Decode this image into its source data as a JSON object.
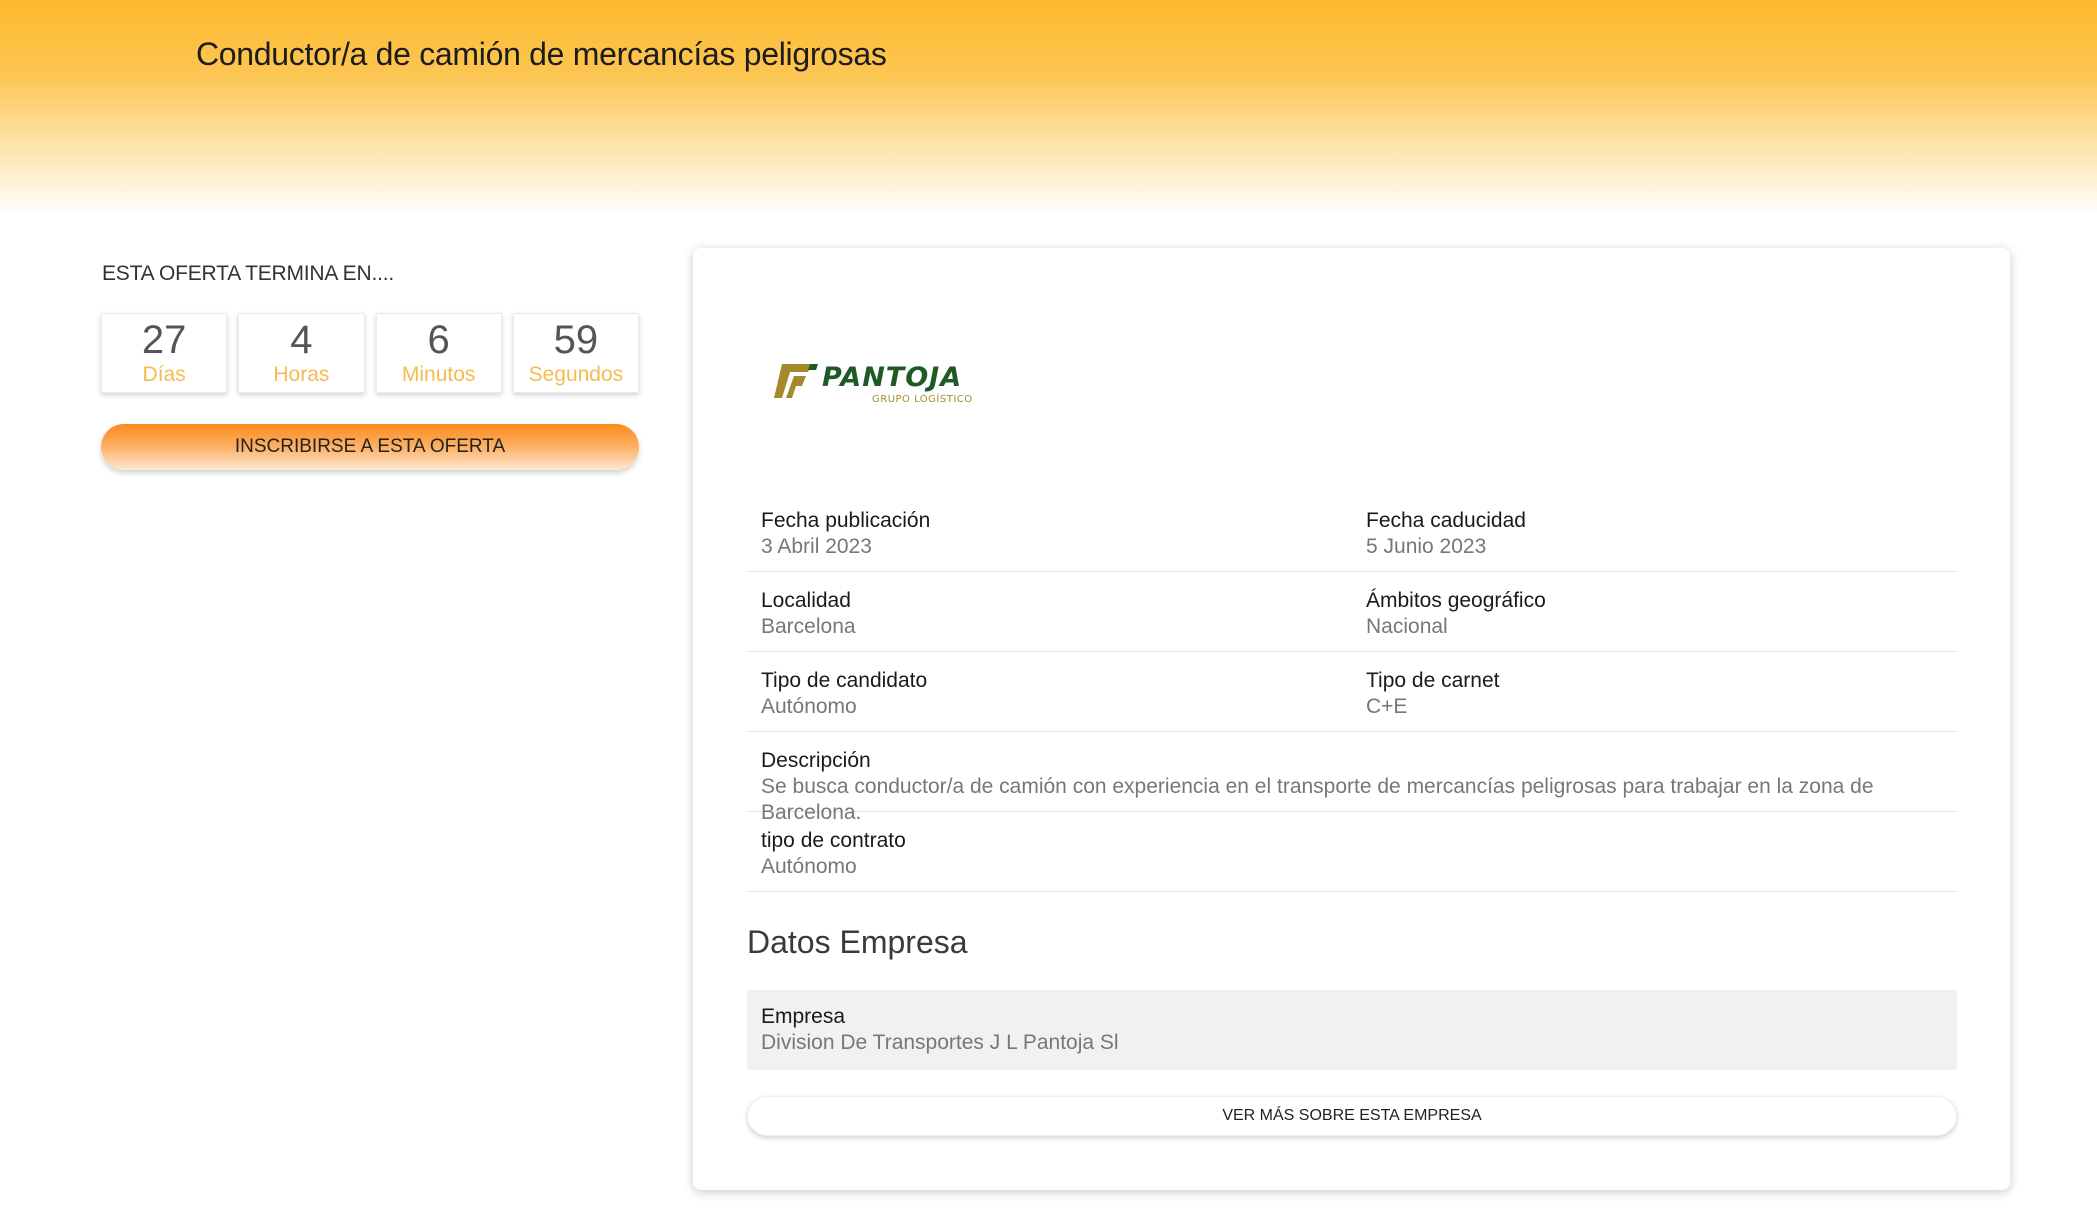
{
  "header": {
    "title": "Conductor/a de camión de mercancías peligrosas"
  },
  "countdown": {
    "title": "ESTA OFERTA TERMINA EN....",
    "units": [
      {
        "value": "27",
        "label": "Días"
      },
      {
        "value": "4",
        "label": "Horas"
      },
      {
        "value": "6",
        "label": "Minutos"
      },
      {
        "value": "59",
        "label": "Segundos"
      }
    ],
    "apply_label": "INSCRIBIRSE A ESTA OFERTA"
  },
  "logo": {
    "name": "PANTOJA",
    "subtitle": "GRUPO LOGÍSTICO"
  },
  "details": {
    "publication": {
      "label": "Fecha publicación",
      "value": "3 Abril 2023"
    },
    "expiry": {
      "label": "Fecha caducidad",
      "value": "5 Junio 2023"
    },
    "location": {
      "label": "Localidad",
      "value": "Barcelona"
    },
    "scope": {
      "label": "Ámbitos geográfico",
      "value": "Nacional"
    },
    "candidate_type": {
      "label": "Tipo de candidato",
      "value": "Autónomo"
    },
    "license_type": {
      "label": "Tipo de carnet",
      "value": "C+E"
    },
    "description": {
      "label": "Descripción",
      "value": "Se busca conductor/a de camión con experiencia en el transporte de mercancías peligrosas para trabajar en la zona de Barcelona."
    },
    "contract": {
      "label": "tipo de contrato",
      "value": "Autónomo"
    }
  },
  "company": {
    "section_title": "Datos Empresa",
    "label": "Empresa",
    "value": "Division De Transportes J L Pantoja Sl",
    "more_label": "VER MÁS SOBRE ESTA EMPRESA"
  },
  "colors": {
    "header_gradient_top": "#fdb92c",
    "accent_orange": "#fb8a1c",
    "countdown_unit": "#f6bb50",
    "logo_green": "#1f5a25",
    "logo_gold": "#a58a2c"
  }
}
